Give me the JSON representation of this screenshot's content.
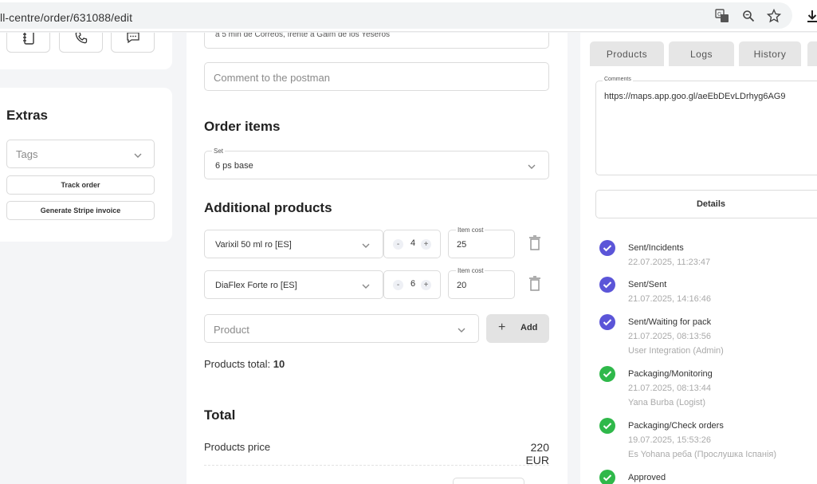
{
  "browser": {
    "url": "ll-centre/order/631088/edit",
    "icons": [
      "translate-icon",
      "zoom-icon",
      "bookmark-star-icon",
      "download-icon"
    ]
  },
  "left": {
    "contact_icons": [
      "notebook-icon",
      "phone-icon",
      "chat-icon"
    ],
    "extras": {
      "title": "Extras",
      "tags_placeholder": "Tags",
      "track_order_label": "Track order",
      "stripe_invoice_label": "Generate Stripe invoice"
    }
  },
  "middle": {
    "address_partial": "a 5 min de Correos, frente a Gaim de los Yeseros",
    "postman_comment_placeholder": "Comment to the postman",
    "order_items": {
      "title": "Order items",
      "set_label": "Set",
      "set_value": "6 ps base"
    },
    "additional_products": {
      "title": "Additional products",
      "item_cost_label": "Item cost",
      "items": [
        {
          "name": "Varixil 50 ml ro [ES]",
          "quantity": "4",
          "cost": "25"
        },
        {
          "name": "DiaFlex Forte ro [ES]",
          "quantity": "6",
          "cost": "20"
        }
      ],
      "product_placeholder": "Product",
      "add_label": "Add",
      "products_total_label": "Products total:",
      "products_total_value": "10"
    },
    "total": {
      "title": "Total",
      "products_price_label": "Products price",
      "products_price_value": "220 EUR"
    },
    "stepper_minus": "-",
    "stepper_plus": "+"
  },
  "right": {
    "tabs": [
      "Products",
      "Logs",
      "History"
    ],
    "comments_label": "Comments",
    "comments_value": "https://maps.app.goo.gl/aeEbDEvLDrhyg6AG9",
    "details_label": "Details",
    "timeline": [
      {
        "status": "Sent/Incidents",
        "date": "22.07.2025, 11:23:47",
        "user": "",
        "color": "#5b55d8"
      },
      {
        "status": "Sent/Sent",
        "date": "21.07.2025, 14:16:46",
        "user": "",
        "color": "#5b55d8"
      },
      {
        "status": "Sent/Waiting for pack",
        "date": "21.07.2025, 08:13:56",
        "user": "User Integration (Admin)",
        "color": "#5b55d8"
      },
      {
        "status": "Packaging/Monitoring",
        "date": "21.07.2025, 08:13:44",
        "user": "Yana Burba (Logist)",
        "color": "#2fb84a"
      },
      {
        "status": "Packaging/Check orders",
        "date": "19.07.2025, 15:53:26",
        "user": "Es Yohana реба (Прослушка Іспанія)",
        "color": "#2fb84a"
      },
      {
        "status": "Approved",
        "date": "",
        "user": "",
        "color": "#2fb84a"
      }
    ]
  }
}
